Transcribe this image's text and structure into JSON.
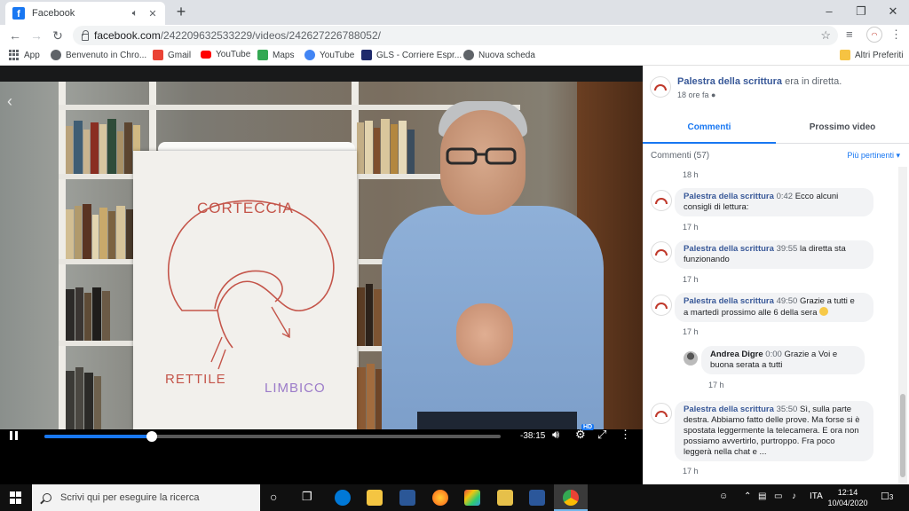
{
  "browser": {
    "tab_title": "Facebook",
    "url_host": "facebook.com",
    "url_path": "/242209632533229/videos/242627226788052/",
    "bookmarks": [
      {
        "label": "App",
        "color": "#5f6368"
      },
      {
        "label": "Benvenuto in Chro...",
        "color": "#5f6368"
      },
      {
        "label": "Gmail",
        "color": "#ea4335"
      },
      {
        "label": "YouTube",
        "color": "#ff0000"
      },
      {
        "label": "Maps",
        "color": "#34a853"
      },
      {
        "label": "YouTube",
        "color": "#4285f4"
      },
      {
        "label": "GLS - Corriere Espr...",
        "color": "#1f2a6b"
      },
      {
        "label": "Nuova scheda",
        "color": "#5f6368"
      }
    ],
    "other_bookmarks": "Altri Preferiti"
  },
  "video": {
    "whiteboard_text": {
      "top": "CORTECCIA",
      "left": "RETTILE",
      "right": "LIMBICO"
    },
    "controls": {
      "time_remaining": "-38:15",
      "progress": 0.235,
      "hd_badge": "HD"
    }
  },
  "post": {
    "page_name": "Palestra della scrittura",
    "status": "era in diretta.",
    "time": "18 ore fa"
  },
  "tabs": {
    "comments": "Commenti",
    "next_video": "Prossimo video"
  },
  "comments_header": {
    "count_label": "Commenti (57)",
    "sort_label": "Più pertinenti"
  },
  "comments": {
    "top_time": "18 h",
    "items": [
      {
        "author": "Palestra della scrittura",
        "stamp": "0:42",
        "text_line1": "Ecco alcuni",
        "text_line2": "consigli di lettura:",
        "time": "17 h"
      },
      {
        "author": "Palestra della scrittura",
        "stamp": "39:55",
        "text_line1": "la diretta sta",
        "text_line2": "funzionando",
        "time": "17 h"
      },
      {
        "author": "Palestra della scrittura",
        "stamp": "49:50",
        "text_line1": "Grazie a tutti e",
        "text_line2": "a martedì prossimo alle 6 della sera",
        "time": "17 h"
      }
    ],
    "reply": {
      "author": "Andrea Digre",
      "stamp": "0:00",
      "text_line1": "Grazie a Voi e",
      "text_line2": "buona serata a tutti",
      "time": "17 h"
    },
    "last": {
      "author": "Palestra della scrittura",
      "stamp": "35:50",
      "lines": [
        "Sì, sulla parte",
        "destra. Abbiamo fatto delle prove. Ma forse si è",
        "spostata leggermente la telecamera. E ora non",
        "possiamo avvertirlo, purtroppo. Fra poco",
        "leggerà nella chat e ..."
      ],
      "time": "17 h"
    }
  },
  "taskbar": {
    "search_placeholder": "Scrivi qui per eseguire la ricerca",
    "language": "ITA",
    "clock_time": "12:14",
    "clock_date": "10/04/2020",
    "notification_count": "3"
  }
}
